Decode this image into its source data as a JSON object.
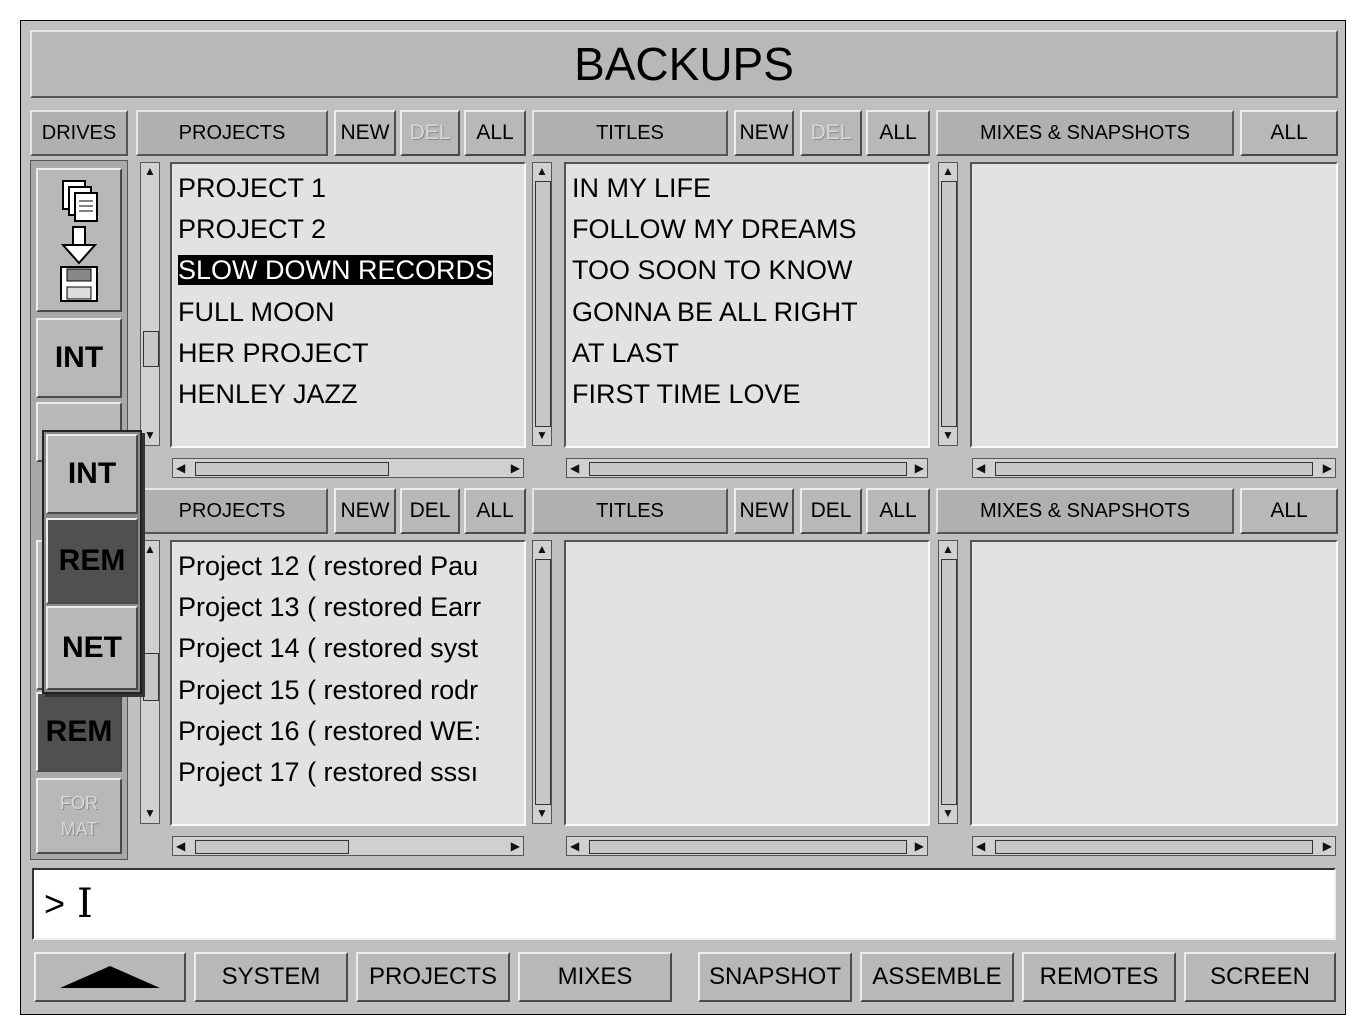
{
  "title": "BACKUPS",
  "drives": {
    "label": "DRIVES",
    "buttons": {
      "int": "INT",
      "rem": "REM",
      "format_line1": "FOR",
      "format_line2": "MAT"
    },
    "popup": [
      "INT",
      "REM",
      "NET"
    ]
  },
  "upper": {
    "projects": {
      "header": "PROJECTS",
      "new": "NEW",
      "del": "DEL",
      "all": "ALL",
      "items": [
        "PROJECT 1",
        "PROJECT 2",
        "SLOW DOWN RECORDS",
        "FULL MOON",
        "HER PROJECT",
        "HENLEY JAZZ"
      ],
      "selected_index": 2
    },
    "titles": {
      "header": "TITLES",
      "new": "NEW",
      "del": "DEL",
      "all": "ALL",
      "items": [
        "IN MY LIFE",
        "FOLLOW MY DREAMS",
        "TOO SOON TO KNOW",
        "GONNA BE ALL RIGHT",
        "AT LAST",
        "FIRST TIME LOVE"
      ]
    },
    "mixes": {
      "header": "MIXES & SNAPSHOTS",
      "all": "ALL",
      "items": []
    }
  },
  "lower": {
    "projects": {
      "header": "PROJECTS",
      "new": "NEW",
      "del": "DEL",
      "all": "ALL",
      "items": [
        "Project 12 ( restored Pau",
        "Project 13 ( restored Earr",
        "Project 14 ( restored syst",
        "Project 15 ( restored rodr",
        "Project 16 ( restored WE:",
        "Project 17 ( restored sssı"
      ]
    },
    "titles": {
      "header": "TITLES",
      "new": "NEW",
      "del": "DEL",
      "all": "ALL",
      "items": []
    },
    "mixes": {
      "header": "MIXES & SNAPSHOTS",
      "all": "ALL",
      "items": []
    }
  },
  "command_line": {
    "prompt": ">",
    "cursor": "I"
  },
  "bottom_bar": {
    "up_icon": "up-triangle-icon",
    "buttons": [
      "SYSTEM",
      "PROJECTS",
      "MIXES",
      "SNAPSHOT",
      "ASSEMBLE",
      "REMOTES",
      "SCREEN"
    ]
  }
}
